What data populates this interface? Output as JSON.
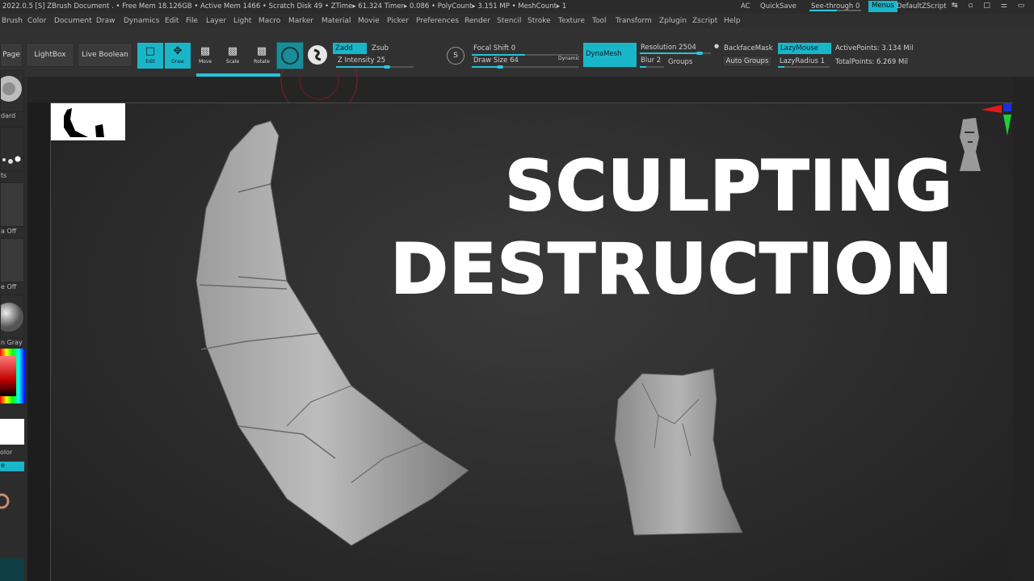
{
  "titlebar": {
    "info": "2022.0.5 [S]  ZBrush Document   .  • Free Mem 18.126GB • Active Mem 1466 • Scratch Disk 49 •  ZTime▸ 61.324 Timer▸ 0.086 • PolyCount▸ 3.151 MP  • MeshCount▸ 1",
    "ac": "AC",
    "quicksave": "QuickSave",
    "see_through": "See-through  0",
    "menus": "Menus",
    "script": "DefaultZScript"
  },
  "menu": [
    "Brush",
    "Color",
    "Document",
    "Draw",
    "Dynamics",
    "Edit",
    "File",
    "Layer",
    "Light",
    "Macro",
    "Marker",
    "Material",
    "Movie",
    "Picker",
    "Preferences",
    "Render",
    "Stencil",
    "Stroke",
    "Texture",
    "Tool",
    "Transform",
    "Zplugin",
    "Zscript",
    "Help"
  ],
  "shelf": {
    "page": "Page",
    "lightbox": "LightBox",
    "live_boolean": "Live Boolean",
    "edit": "Edit",
    "draw": "Draw",
    "move": "Move",
    "scale": "Scale",
    "rotate": "Rotate",
    "zadd": "Zadd",
    "zsub": "Zsub",
    "z_intensity_label": "Z Intensity",
    "z_intensity_value": "25",
    "focal_shift_label": "Focal Shift",
    "focal_shift_value": "0",
    "draw_size_label": "Draw Size",
    "draw_size_value": "64",
    "dynamic": "Dynamic",
    "dynamesh": "DynaMesh",
    "resolution_label": "Resolution",
    "resolution_value": "2504",
    "blur_label": "Blur",
    "blur_value": "2",
    "groups": "Groups",
    "backface_mask": "BackfaceMask",
    "auto_groups": "Auto Groups",
    "lazy_mouse": "LazyMouse",
    "lazy_radius": "LazyRadius 1",
    "active_points": "ActivePoints: 3.134 Mil",
    "total_points": "TotalPoints: 6.269 Mil"
  },
  "leftbar": {
    "standard": "dard",
    "dots": "ts",
    "alpha_off": "a Off",
    "texture_off": "e Off",
    "material": "n Gray",
    "color": "olor",
    "slot": "e"
  },
  "headline": {
    "line1": "SCULPTING",
    "line2": "DESTRUCTION"
  },
  "colors": {
    "accent": "#19b6c9",
    "panel": "#313131",
    "canvas": "#2c2c2c",
    "text": "#ffffff"
  }
}
